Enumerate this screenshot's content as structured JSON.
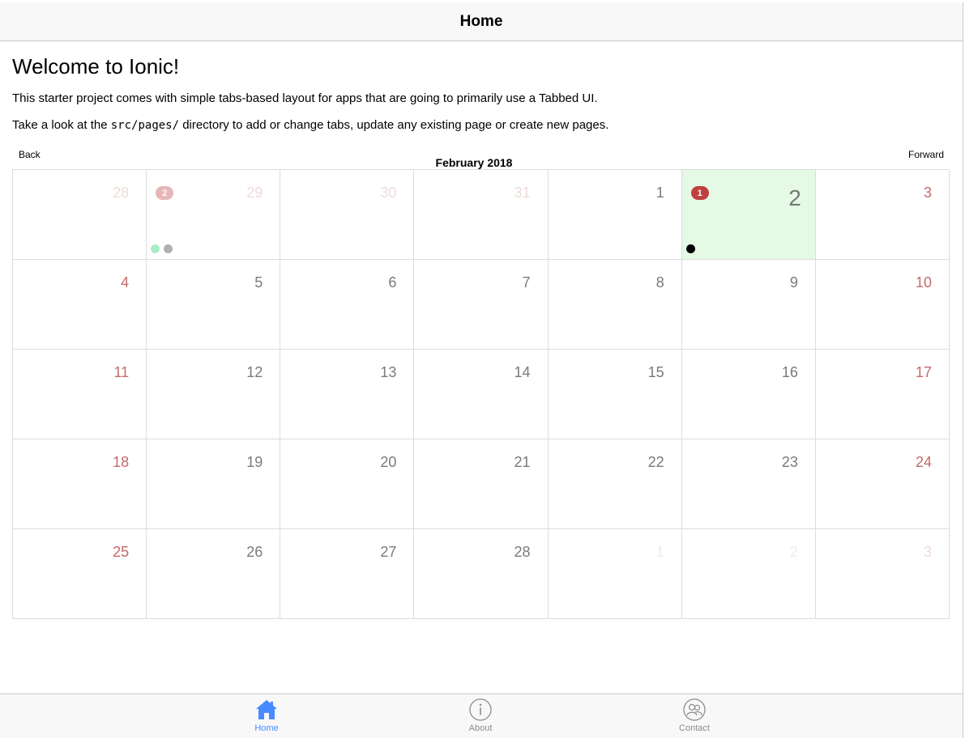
{
  "header": {
    "title": "Home"
  },
  "intro": {
    "heading": "Welcome to Ionic!",
    "paragraph1": "This starter project comes with simple tabs-based layout for apps that are going to primarily use a Tabbed UI.",
    "paragraph2_prefix": "Take a look at the ",
    "paragraph2_code": "src/pages/",
    "paragraph2_suffix": " directory to add or change tabs, update any existing page or create new pages."
  },
  "calendar": {
    "back_label": "Back",
    "forward_label": "Forward",
    "month_title": "February 2018",
    "days": [
      {
        "label": "28",
        "state": "prev",
        "weekend": true
      },
      {
        "label": "29",
        "state": "prev",
        "weekend": false,
        "badge": "2",
        "badge_color": "#e7b7b7",
        "dots": [
          "#a9ecc9",
          "#b0b0b0"
        ]
      },
      {
        "label": "30",
        "state": "prev",
        "weekend": false
      },
      {
        "label": "31",
        "state": "prev",
        "weekend": false
      },
      {
        "label": "1",
        "state": "current",
        "weekend": false
      },
      {
        "label": "2",
        "state": "today",
        "weekend": false,
        "badge": "1",
        "badge_color": "#c0403f",
        "dots": [
          "#000000"
        ]
      },
      {
        "label": "3",
        "state": "current",
        "weekend": true
      },
      {
        "label": "4",
        "state": "current",
        "weekend": true
      },
      {
        "label": "5",
        "state": "current",
        "weekend": false
      },
      {
        "label": "6",
        "state": "current",
        "weekend": false
      },
      {
        "label": "7",
        "state": "current",
        "weekend": false
      },
      {
        "label": "8",
        "state": "current",
        "weekend": false
      },
      {
        "label": "9",
        "state": "current",
        "weekend": false
      },
      {
        "label": "10",
        "state": "current",
        "weekend": true
      },
      {
        "label": "11",
        "state": "current",
        "weekend": true
      },
      {
        "label": "12",
        "state": "current",
        "weekend": false
      },
      {
        "label": "13",
        "state": "current",
        "weekend": false
      },
      {
        "label": "14",
        "state": "current",
        "weekend": false
      },
      {
        "label": "15",
        "state": "current",
        "weekend": false
      },
      {
        "label": "16",
        "state": "current",
        "weekend": false
      },
      {
        "label": "17",
        "state": "current",
        "weekend": true
      },
      {
        "label": "18",
        "state": "current",
        "weekend": true
      },
      {
        "label": "19",
        "state": "current",
        "weekend": false
      },
      {
        "label": "20",
        "state": "current",
        "weekend": false
      },
      {
        "label": "21",
        "state": "current",
        "weekend": false
      },
      {
        "label": "22",
        "state": "current",
        "weekend": false
      },
      {
        "label": "23",
        "state": "current",
        "weekend": false
      },
      {
        "label": "24",
        "state": "current",
        "weekend": true
      },
      {
        "label": "25",
        "state": "current",
        "weekend": true
      },
      {
        "label": "26",
        "state": "current",
        "weekend": false
      },
      {
        "label": "27",
        "state": "current",
        "weekend": false
      },
      {
        "label": "28",
        "state": "current",
        "weekend": false
      },
      {
        "label": "1",
        "state": "next",
        "weekend": false
      },
      {
        "label": "2",
        "state": "next",
        "weekend": false
      },
      {
        "label": "3",
        "state": "next",
        "weekend": true
      }
    ]
  },
  "tabs": [
    {
      "label": "Home",
      "icon": "home-icon",
      "active": true
    },
    {
      "label": "About",
      "icon": "info-icon",
      "active": false
    },
    {
      "label": "Contact",
      "icon": "contacts-icon",
      "active": false
    }
  ],
  "colors": {
    "accent": "#488aff",
    "today_bg": "#e5f9e5",
    "weekend": "#c46a6a"
  }
}
